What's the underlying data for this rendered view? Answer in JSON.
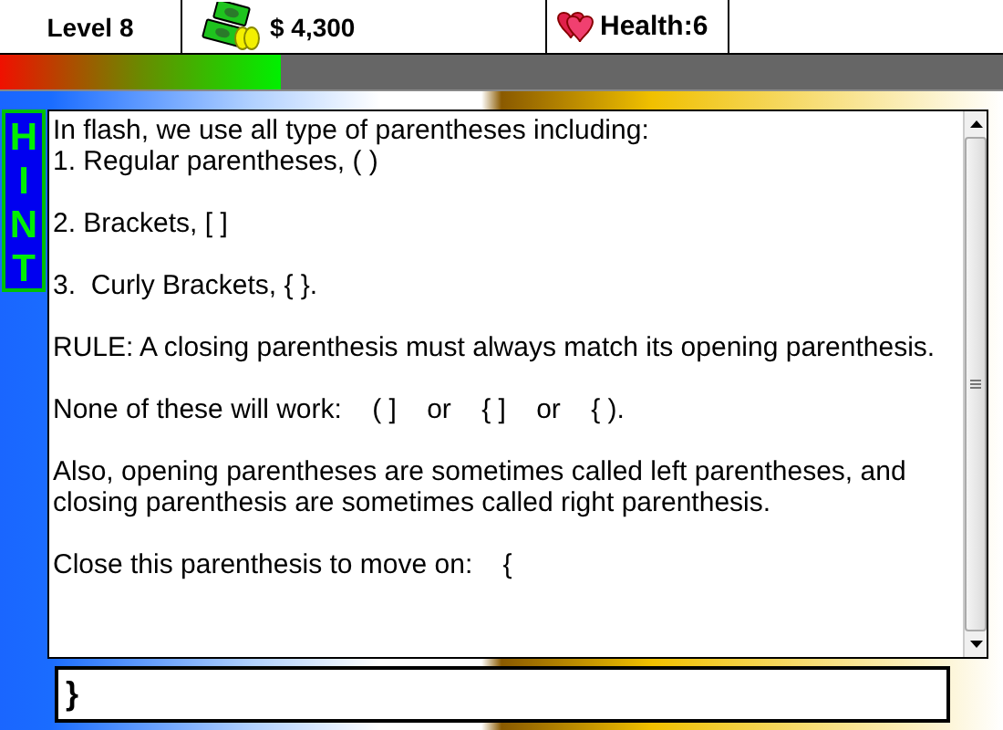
{
  "header": {
    "level": "Level 8",
    "money": "$ 4,300",
    "health": "Health:6"
  },
  "progress": {
    "level": 0.28
  },
  "hint_label": "HINT",
  "hint_paragraphs": [
    [
      "In flash, we use all type of parentheses including:",
      "1. Regular parentheses, ( )"
    ],
    [
      "2. Brackets, [ ]"
    ],
    [
      "3.  Curly Brackets, { }."
    ],
    [
      "RULE: A closing parenthesis must always match its opening parenthesis."
    ],
    [
      "None of these will work:    ( ]    or    { ]    or    { )."
    ],
    [
      "Also, opening parentheses are sometimes called left parentheses, and closing parenthesis are sometimes called right parenthesis."
    ],
    [
      "Close this parenthesis to move on:    {"
    ]
  ],
  "answer": {
    "value": "}"
  }
}
